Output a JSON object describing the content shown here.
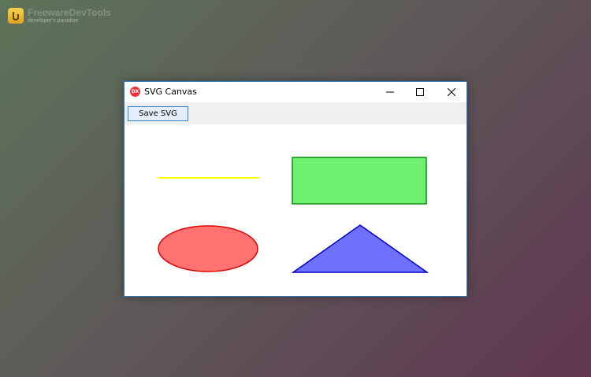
{
  "window": {
    "title": "SVG Canvas",
    "app_icon_text": "DX",
    "controls": [
      "minimize-icon",
      "maximize-icon",
      "close-icon"
    ]
  },
  "toolbar": {
    "save_label": "Save SVG"
  },
  "colors": {
    "window_border": "#2b7bc1",
    "line_stroke": "#ffff00",
    "rect_fill": "#70f070",
    "rect_stroke": "#0c8a16",
    "ellipse_fill": "#ff7272",
    "ellipse_stroke": "#e00000",
    "triangle_fill": "#7070ff",
    "triangle_stroke": "#0000cc"
  },
  "canvas": {
    "shapes": [
      "line",
      "rectangle",
      "ellipse",
      "triangle"
    ]
  }
}
